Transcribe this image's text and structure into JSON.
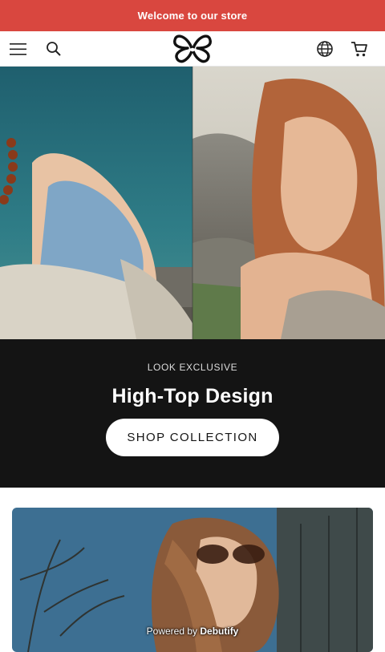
{
  "announcement": {
    "text": "Welcome to our store"
  },
  "header": {
    "icons": [
      "menu-icon",
      "search-icon",
      "butterfly-logo",
      "globe-icon",
      "cart-icon"
    ]
  },
  "banner": {
    "eyebrow": "LOOK EXCLUSIVE",
    "title": "High-Top Design",
    "button_label": "SHOP COLLECTION"
  },
  "footer": {
    "powered_prefix": "Powered by",
    "powered_brand": "Debutify"
  },
  "colors": {
    "announcement_bg": "#d9473f",
    "banner_bg": "#141414"
  }
}
